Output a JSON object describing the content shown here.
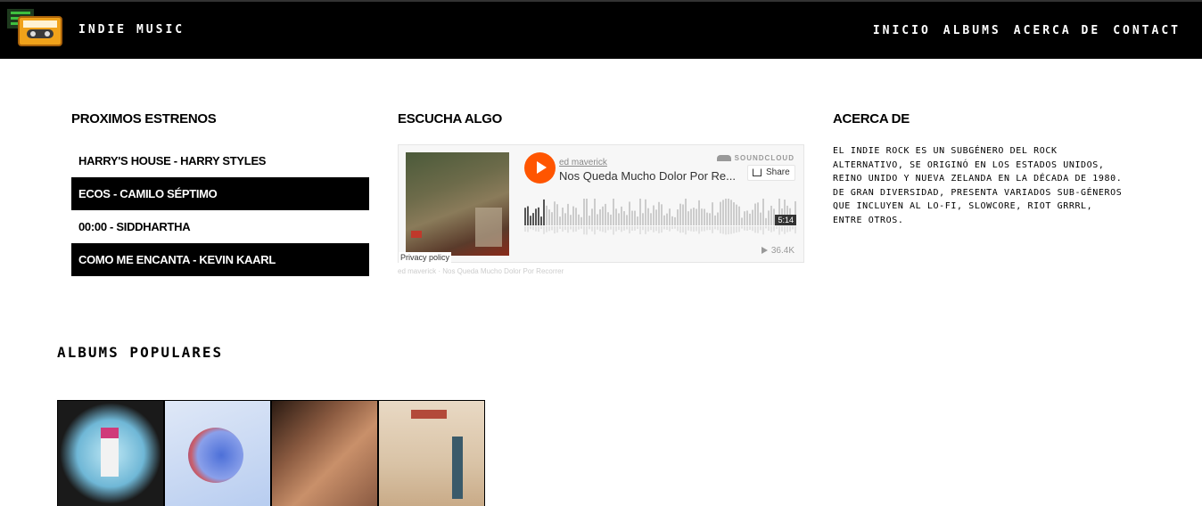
{
  "header": {
    "brand": "INDIE MUSIC",
    "nav": [
      "INICIO",
      "ALBUMS",
      "ACERCA DE",
      "CONTACT"
    ]
  },
  "releases": {
    "title": "PROXIMOS ESTRENOS",
    "items": [
      "HARRY'S HOUSE - HARRY STYLES",
      "ECOS - CAMILO SÉPTIMO",
      "00:00 - SIDDHARTHA",
      "COMO ME ENCANTA - KEVIN KAARL"
    ]
  },
  "listen": {
    "title": "ESCUCHA ALGO",
    "user": "ed maverick",
    "track": "Nos Queda Mucho Dolor Por Re...",
    "brand": "SOUNDCLOUD",
    "share": "Share",
    "duration": "5:14",
    "plays": "36.4K",
    "privacy": "Privacy policy",
    "caption": "ed maverick · Nos Queda Mucho Dolor Por Recorrer"
  },
  "about": {
    "title": "ACERCA DE",
    "text": "EL INDIE ROCK ES UN SUBGÉNERO DEL ROCK ALTERNATIVO, SE ORIGINÓ EN LOS ESTADOS UNIDOS, REINO UNIDO Y NUEVA ZELANDA EN LA DÉCADA DE 1980. DE GRAN DIVERSIDAD, PRESENTA VARIADOS SUB-GÉNEROS QUE INCLUYEN AL LO-FI, SLOWCORE, RIOT GRRRL, ENTRE OTROS."
  },
  "albums": {
    "title": "ALBUMS POPULARES"
  }
}
